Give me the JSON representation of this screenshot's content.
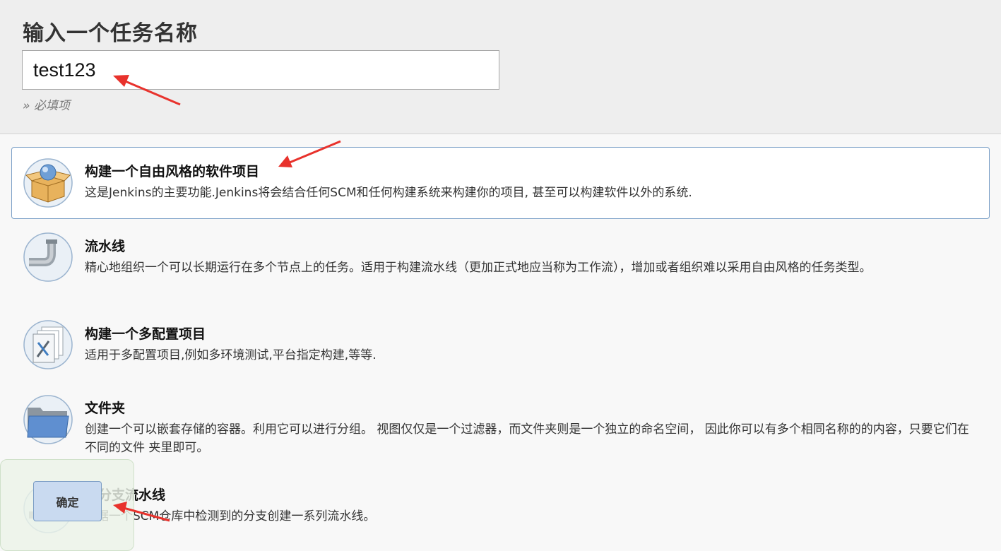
{
  "header": {
    "title": "输入一个任务名称",
    "name_input_value": "test123",
    "required_note": "» 必填项"
  },
  "items": [
    {
      "title": "构建一个自由风格的软件项目",
      "description": "这是Jenkins的主要功能.Jenkins将会结合任何SCM和任何构建系统来构建你的项目, 甚至可以构建软件以外的系统.",
      "icon": "freestyle-box-icon",
      "selected": true
    },
    {
      "title": "流水线",
      "description": "精心地组织一个可以长期运行在多个节点上的任务。适用于构建流水线（更加正式地应当称为工作流），增加或者组织难以采用自由风格的任务类型。",
      "icon": "pipeline-icon"
    },
    {
      "title": "构建一个多配置项目",
      "description": "适用于多配置项目,例如多环境测试,平台指定构建,等等.",
      "icon": "multi-config-icon"
    },
    {
      "title": "文件夹",
      "description": "创建一个可以嵌套存储的容器。利用它可以进行分组。 视图仅仅是一个过滤器，而文件夹则是一个独立的命名空间， 因此你可以有多个相同名称的的内容，只要它们在不同的文件 夹里即可。",
      "icon": "folder-icon"
    },
    {
      "title": "多分支流水线",
      "description": "根据一个SCM仓库中检测到的分支创建一系列流水线。",
      "icon": "multibranch-icon"
    }
  ],
  "ok_button": {
    "label": "确定"
  },
  "colors": {
    "header_bg": "#eeeeee",
    "page_bg": "#f8f8f8",
    "selected_border": "#7ba0c7",
    "ok_button_bg": "#c9daf0",
    "annotation_arrow": "#e8322c"
  }
}
